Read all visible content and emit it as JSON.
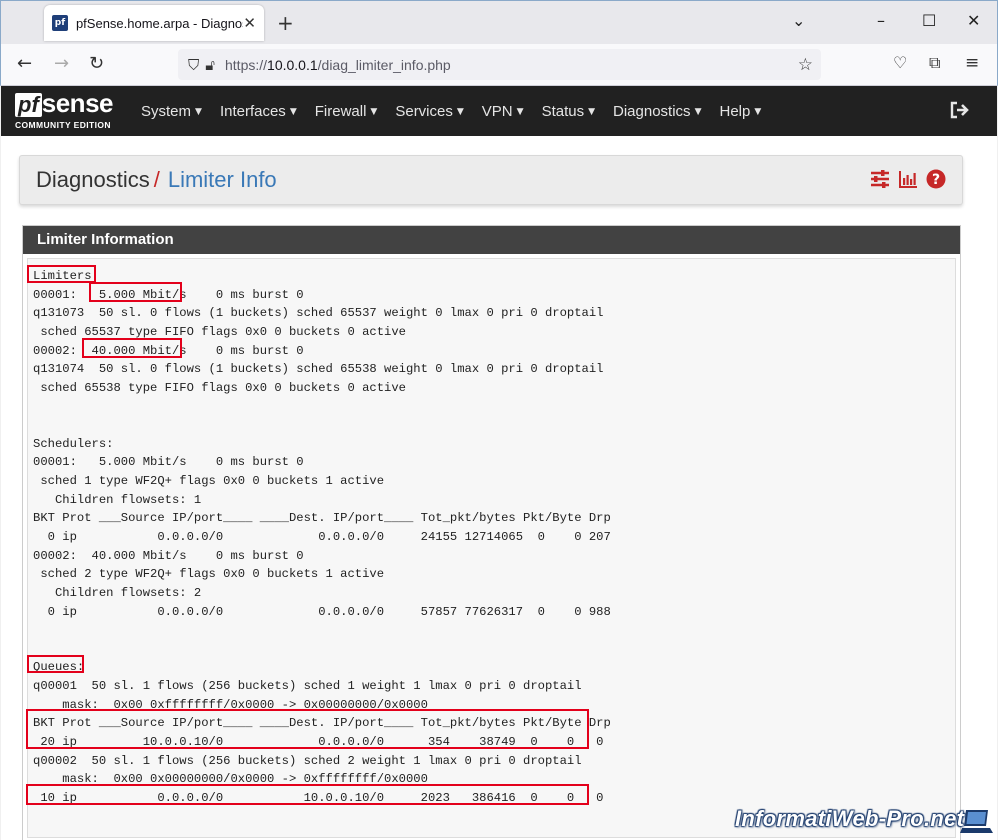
{
  "browser": {
    "tab_title": "pfSense.home.arpa - Diagnostic",
    "favicon_text": "pf",
    "url_prefix": "https://",
    "url_host": "10.0.0.1",
    "url_path": "/diag_limiter_info.php"
  },
  "header": {
    "logo_pf": "pf",
    "logo_sense": "sense",
    "logo_sub": "COMMUNITY EDITION",
    "menu": [
      "System",
      "Interfaces",
      "Firewall",
      "Services",
      "VPN",
      "Status",
      "Diagnostics",
      "Help"
    ]
  },
  "breadcrumb": {
    "parent": "Diagnostics",
    "separator": "/",
    "current": "Limiter Info"
  },
  "panel": {
    "title": "Limiter Information",
    "lines": [
      "Limiters:",
      "00001:   5.000 Mbit/s    0 ms burst 0",
      "q131073  50 sl. 0 flows (1 buckets) sched 65537 weight 0 lmax 0 pri 0 droptail",
      " sched 65537 type FIFO flags 0x0 0 buckets 0 active",
      "00002:  40.000 Mbit/s    0 ms burst 0",
      "q131074  50 sl. 0 flows (1 buckets) sched 65538 weight 0 lmax 0 pri 0 droptail",
      " sched 65538 type FIFO flags 0x0 0 buckets 0 active",
      "",
      "",
      "Schedulers:",
      "00001:   5.000 Mbit/s    0 ms burst 0",
      " sched 1 type WF2Q+ flags 0x0 0 buckets 1 active",
      "   Children flowsets: 1",
      "BKT Prot ___Source IP/port____ ____Dest. IP/port____ Tot_pkt/bytes Pkt/Byte Drp",
      "  0 ip           0.0.0.0/0             0.0.0.0/0     24155 12714065  0    0 207",
      "00002:  40.000 Mbit/s    0 ms burst 0",
      " sched 2 type WF2Q+ flags 0x0 0 buckets 1 active",
      "   Children flowsets: 2",
      "  0 ip           0.0.0.0/0             0.0.0.0/0     57857 77626317  0    0 988",
      "",
      "",
      "Queues:",
      "q00001  50 sl. 1 flows (256 buckets) sched 1 weight 1 lmax 0 pri 0 droptail",
      "    mask:  0x00 0xffffffff/0x0000 -> 0x00000000/0x0000",
      "BKT Prot ___Source IP/port____ ____Dest. IP/port____ Tot_pkt/bytes Pkt/Byte Drp",
      " 20 ip         10.0.0.10/0             0.0.0.0/0      354    38749  0    0   0",
      "q00002  50 sl. 1 flows (256 buckets) sched 2 weight 1 lmax 0 pri 0 droptail",
      "    mask:  0x00 0x00000000/0x0000 -> 0xffffffff/0x0000",
      " 10 ip           0.0.0.0/0           10.0.0.10/0     2023   386416  0    0   0"
    ]
  },
  "watermark": "InformatiWeb-Pro.net",
  "colors": {
    "highlight": "#e3001b",
    "breadcrumb_link": "#3a79b7",
    "header_bg": "#212121",
    "panel_heading": "#424242"
  }
}
